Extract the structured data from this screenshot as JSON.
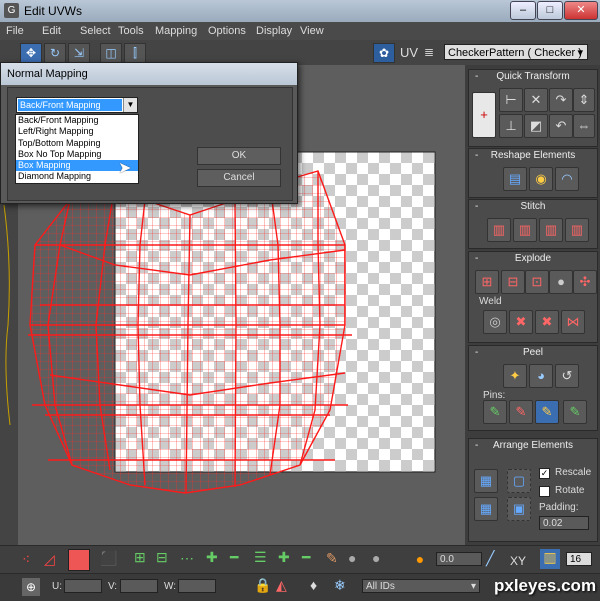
{
  "window": {
    "title": "Edit UVWs",
    "app_icon": "G"
  },
  "menu": [
    "File",
    "Edit",
    "Select",
    "Tools",
    "Mapping",
    "Options",
    "Display",
    "View"
  ],
  "toolbar": {
    "uv_label": "UV",
    "texture_select": "CheckerPattern  ( Checker )"
  },
  "dialog": {
    "title": "Normal Mapping",
    "dropdown_value": "Back/Front Mapping",
    "options": [
      "Back/Front Mapping",
      "Left/Right Mapping",
      "Top/Bottom Mapping",
      "Box No Top Mapping",
      "Box Mapping",
      "Diamond Mapping"
    ],
    "highlighted_option": "Box Mapping",
    "ok_label": "OK",
    "cancel_label": "Cancel"
  },
  "panel": {
    "quick_transform": "Quick Transform",
    "reshape": "Reshape Elements",
    "stitch": "Stitch",
    "explode": "Explode",
    "weld": "Weld",
    "peel": "Peel",
    "pins": "Pins:",
    "arrange": "Arrange Elements",
    "rescale": "Rescale",
    "rotate": "Rotate",
    "padding_label": "Padding:",
    "padding_value": "0.02",
    "rescale_checked": true,
    "rotate_checked": false
  },
  "bottom": {
    "u_label": "U:",
    "v_label": "V:",
    "w_label": "W:",
    "spin_value": "0.0",
    "xy_label": "XY",
    "num_value": "16",
    "ids_value": "All IDs"
  },
  "watermark": "pxleyes.com",
  "colors": {
    "selection_blue": "#3399ff",
    "wire_red": "#ff2020"
  }
}
